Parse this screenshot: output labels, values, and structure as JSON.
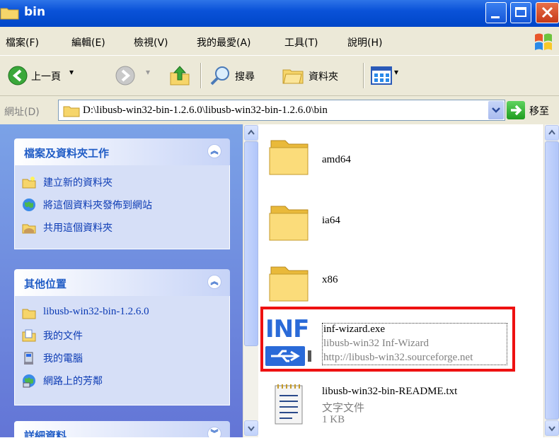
{
  "window": {
    "title": "bin"
  },
  "menu": {
    "items": [
      "檔案(F)",
      "編輯(E)",
      "檢視(V)",
      "我的最愛(A)",
      "工具(T)",
      "說明(H)"
    ]
  },
  "toolbar": {
    "back_label": "上一頁",
    "search_label": "搜尋",
    "folders_label": "資料夾"
  },
  "address": {
    "label": "網址(D)",
    "path": "D:\\libusb-win32-bin-1.2.6.0\\libusb-win32-bin-1.2.6.0\\bin",
    "go_label": "移至"
  },
  "sidebar": {
    "file_tasks": {
      "title": "檔案及資料夾工作",
      "items": [
        "建立新的資料夾",
        "將這個資料夾發佈到網站",
        "共用這個資料夾"
      ]
    },
    "other_places": {
      "title": "其他位置",
      "items": [
        "libusb-win32-bin-1.2.6.0",
        "我的文件",
        "我的電腦",
        "網路上的芳鄰"
      ]
    },
    "details": {
      "title": "詳細資料"
    }
  },
  "files": [
    {
      "name": "amd64",
      "type": "folder"
    },
    {
      "name": "ia64",
      "type": "folder"
    },
    {
      "name": "x86",
      "type": "folder"
    },
    {
      "name": "inf-wizard.exe",
      "line2": "libusb-win32 Inf-Wizard",
      "line3": "http://libusb-win32.sourceforge.net",
      "icon_text": "INF",
      "type": "exe"
    },
    {
      "name": "libusb-win32-bin-README.txt",
      "line2": "文字文件",
      "line3": "1 KB",
      "type": "txt"
    }
  ],
  "colors": {
    "titlebar": "#0a52d8",
    "sidebar_bg": "#6f8ee0",
    "panel_title": "#215dc6",
    "highlight": "#ee1111"
  }
}
